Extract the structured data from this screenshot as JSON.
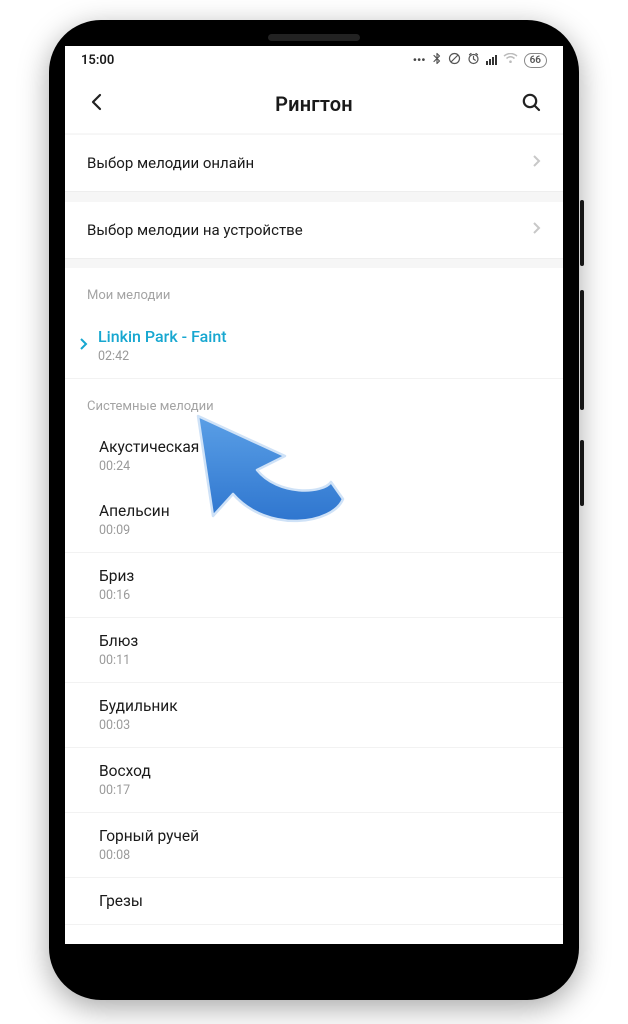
{
  "status": {
    "time": "15:00",
    "battery": "66"
  },
  "header": {
    "title": "Рингтон"
  },
  "menu": {
    "online": "Выбор мелодии онлайн",
    "device": "Выбор мелодии на устройстве"
  },
  "sections": {
    "my_label": "Мои мелодии",
    "system_label": "Системные мелодии"
  },
  "my_ringtone": {
    "title": "Linkin Park - Faint",
    "duration": "02:42"
  },
  "system_ringtones": [
    {
      "title": "Акустическая гитара",
      "duration": "00:24"
    },
    {
      "title": "Апельсин",
      "duration": "00:09"
    },
    {
      "title": "Бриз",
      "duration": "00:16"
    },
    {
      "title": "Блюз",
      "duration": "00:11"
    },
    {
      "title": "Будильник",
      "duration": "00:03"
    },
    {
      "title": "Восход",
      "duration": "00:17"
    },
    {
      "title": "Горный ручей",
      "duration": "00:08"
    },
    {
      "title": "Грезы",
      "duration": ""
    }
  ],
  "colors": {
    "accent": "#17a7d0"
  }
}
